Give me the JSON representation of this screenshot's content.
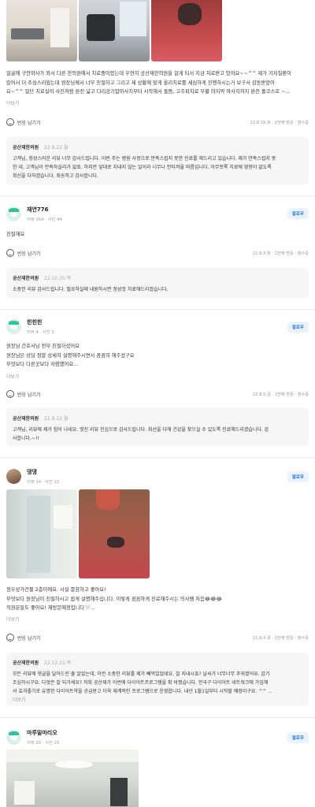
{
  "reviews": [
    {
      "text_lines": [
        "얼굴에 구안와사가 와서 다른 한의원에서 치료중이었는데 우연히 공산재한의원을 알게 되서 지금 치료받고 있어요~~^^ 제가 기저질환이",
        "있어서 더 조심스러웠는데 원장님께서 너무 친절하고 그리고 제 상황에 맞게 올리치료를 세심하게 진행하시는거 보구서 감동받았어",
        "요~^^ 일단 치료실이 사진처럼 완전 넓고 다리공기압마사지부터 시작해서 돌뜸, 고주파치료 부황 마지막 마사지까지 완전 풀코스로 ~..."
      ],
      "more": "더보기",
      "react": "반응 남기기",
      "meta": "22.8.16.화 · 2번째 방문 · 영수증",
      "reply": {
        "name": "공산재한의원",
        "date": "22.8.22.월",
        "lines": [
          "고객님, 정성스러운 리뷰 너무 감사드립니다. 이번 주는 병원 사정으로 만족스럽지 못한 진료를 해드리고 있습니다. 제가 만족스럽지 못",
          "한 데, 고객님이 만족하실리가 없죠. 하지만 앞대로 지내지 않는 일이라 너무나 안타까울 따름입니다. 아무쪼록 치료에 영향이 없도록",
          "회선을 다하겠습니다. 죄송하고 감사합니다."
        ]
      }
    },
    {
      "name": "재연776",
      "stat": "리뷰 154 · 사진 44",
      "follow": "팔로우",
      "text_lines": [
        "친절해요"
      ],
      "react": "반응 남기기",
      "meta": "22.8.9.화 · 1번째 방문 · 영수증",
      "reply": {
        "name": "공산재한의원",
        "date": "22.10.20.목",
        "lines": [
          "소중한 리뷰 감사드립니다. 필요하실때 내원하시면 정성껏 치료해드리겠습니다."
        ]
      }
    },
    {
      "name": "힌힌힌",
      "stat": "리뷰 4 · 사진 3",
      "follow": "팔로우",
      "text_lines": [
        "원장님 간호사님 전부 친절하셨어요",
        "원장님은 상담 정말 상세히 설명해주시면서 꼼꼼히 해주셨구요",
        "무엇보다 다른곳보다 저렴했어요..."
      ],
      "more": "더보기",
      "react": "반응 남기기",
      "meta": "22.8.5.금 · 1번째 방문 · 영수증",
      "reply": {
        "name": "공산재한의원",
        "date": "22.8.22.월",
        "lines": [
          "고객님, 리뷰에 제가 힘이 나네요. 멋진 리뷰 진심으로 감사드립니다. 최선을 다해 건강을 찾으실 수 있도록 진료해드리겠습니다. 감",
          "사합니다.~!!"
        ]
      }
    },
    {
      "name": "댕댕",
      "stat": "리뷰 14 · 사진 12",
      "follow": "팔로우",
      "text_lines": [
        "정우상가건물 2층이에요. 시설 깔끔하고 좋아요!",
        "무엇보다 원장님이 친절하시고 쉽게 설명해주십니다. 이렇게 꼼꼼하게 진료해주시는 의사쌤 처음😂😂😂",
        "직원분들도 좋아요! 재방문예정입니다🤍..."
      ],
      "more": "더보기",
      "react": "반응 남기기",
      "meta": "22.8.4.목 · 1번째 방문 · 영수증",
      "reply": {
        "name": "공산재한의원",
        "date": "22.12.22.목",
        "lines": [
          "모든 리뷰에 댓글을 달아드린 줄 알았는데, 이런 소중한 리뷰를 제가 빼먹었었네요. 잘 지내시죠? 날씨가 너무너무 추워졌어요. 감기",
          "조심하시구요. 다엇은 잘 되가세요? 저희 공산재가 이번에 다이어트프로그램을 확 바꿨습니다. 전국구 다이어트 네트워크에 가입해",
          "서 효과좋기로 유명한 다이어트약을 공급받고 더욱 체계적인 프로그램으로 운영합니다. 내년 1월1일부터 시작할 예정이구요. ^^ ..."
        ],
        "more": "더보기"
      }
    },
    {
      "name": "마루밀마리오",
      "stat": "리뷰 20 · 사진 25",
      "follow": "팔로우"
    }
  ]
}
